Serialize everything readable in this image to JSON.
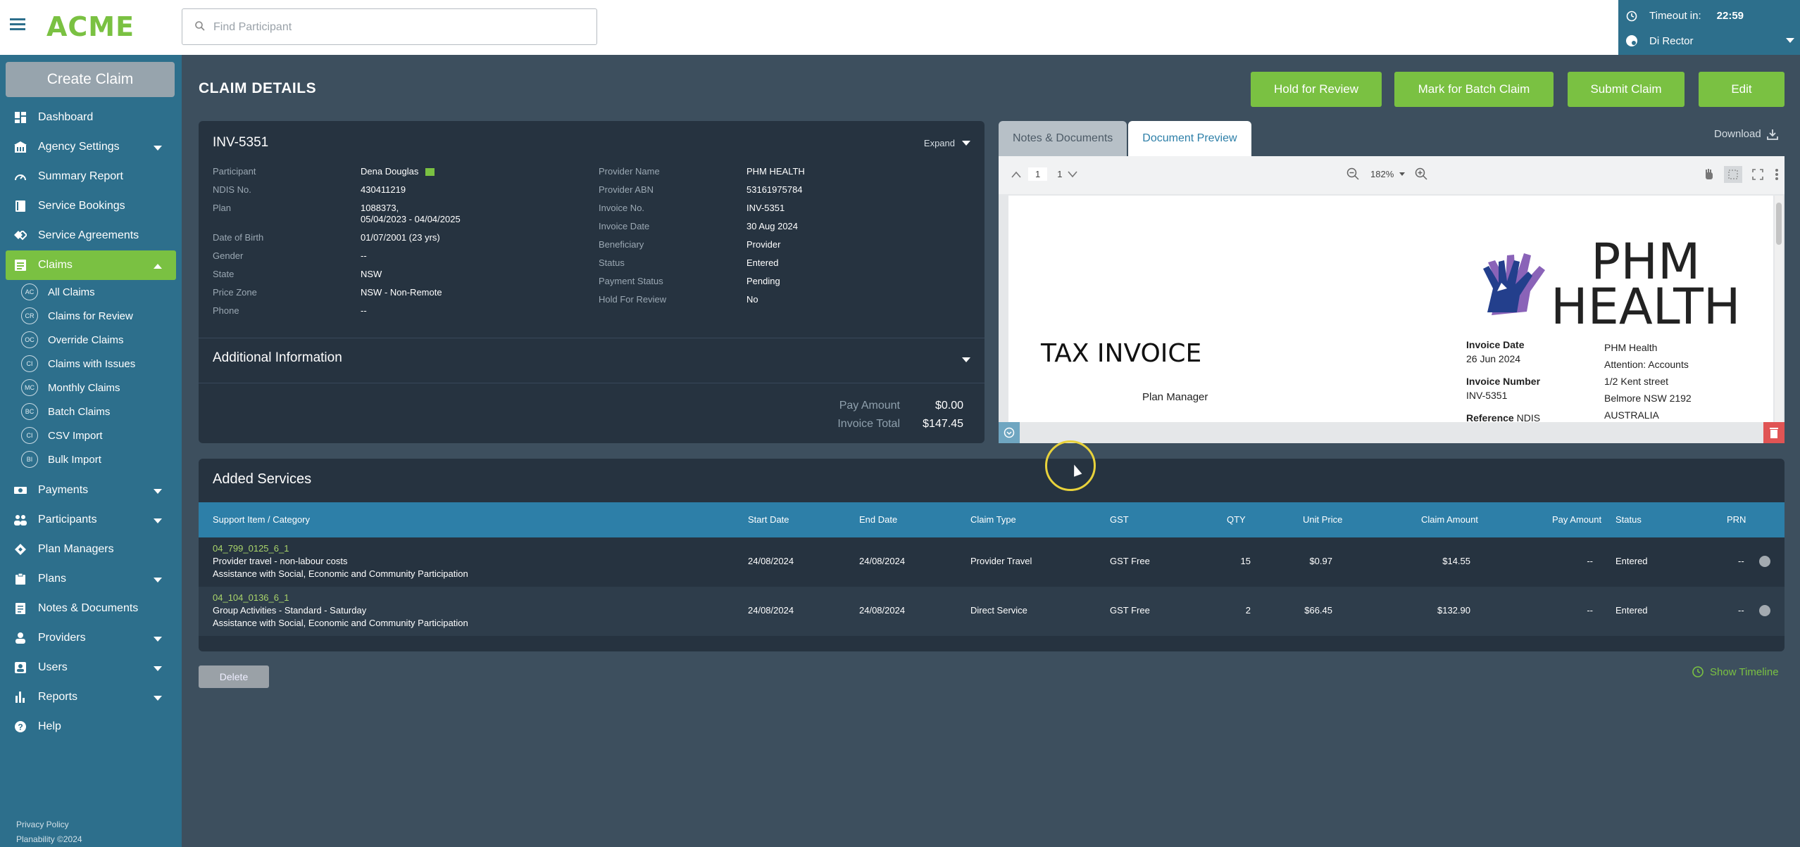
{
  "app": {
    "logo": "ACME",
    "search_placeholder": "Find Participant",
    "timeout_label": "Timeout in:",
    "timeout_value": "22:59",
    "user_name": "Di Rector"
  },
  "sidebar": {
    "create_claim": "Create Claim",
    "items": [
      {
        "label": "Dashboard",
        "icon": "dashboard-icon"
      },
      {
        "label": "Agency Settings",
        "icon": "building-icon"
      },
      {
        "label": "Summary Report",
        "icon": "gauge-icon"
      },
      {
        "label": "Service Bookings",
        "icon": "book-icon"
      },
      {
        "label": "Service Agreements",
        "icon": "handshake-icon"
      },
      {
        "label": "Claims",
        "icon": "list-icon"
      },
      {
        "label": "Payments",
        "icon": "money-icon"
      },
      {
        "label": "Participants",
        "icon": "people-icon"
      },
      {
        "label": "Plan Managers",
        "icon": "diamond-icon"
      },
      {
        "label": "Plans",
        "icon": "clipboard-icon"
      },
      {
        "label": "Notes & Documents",
        "icon": "document-icon"
      },
      {
        "label": "Providers",
        "icon": "provider-icon"
      },
      {
        "label": "Users",
        "icon": "user-icon"
      },
      {
        "label": "Reports",
        "icon": "bar-chart-icon"
      },
      {
        "label": "Help",
        "icon": "question-icon"
      }
    ],
    "claims_sub": [
      {
        "badge": "AC",
        "label": "All Claims"
      },
      {
        "badge": "CR",
        "label": "Claims for Review"
      },
      {
        "badge": "OC",
        "label": "Override Claims"
      },
      {
        "badge": "CI",
        "label": "Claims with Issues"
      },
      {
        "badge": "MC",
        "label": "Monthly Claims"
      },
      {
        "badge": "BC",
        "label": "Batch Claims"
      },
      {
        "badge": "CI",
        "label": "CSV Import"
      },
      {
        "badge": "BI",
        "label": "Bulk Import"
      }
    ],
    "footer": {
      "privacy": "Privacy Policy",
      "copyright": "Planability ©2024"
    }
  },
  "page": {
    "title": "CLAIM DETAILS",
    "actions": {
      "hold": "Hold for Review",
      "batch": "Mark for Batch Claim",
      "submit": "Submit Claim",
      "edit": "Edit"
    }
  },
  "claim": {
    "invoice_id": "INV-5351",
    "expand": "Expand",
    "left_fields": [
      {
        "label": "Participant",
        "value": "Dena Douglas"
      },
      {
        "label": "NDIS No.",
        "value": "430411219"
      },
      {
        "label": "Plan",
        "value": "1088373,",
        "value2": "05/04/2023 - 04/04/2025"
      },
      {
        "label": "Date of Birth",
        "value": "01/07/2001  (23 yrs)"
      },
      {
        "label": "Gender",
        "value": "--"
      },
      {
        "label": "State",
        "value": "NSW"
      },
      {
        "label": "Price Zone",
        "value": "NSW - Non-Remote"
      },
      {
        "label": "Phone",
        "value": "--"
      }
    ],
    "right_fields": [
      {
        "label": "Provider Name",
        "value": "PHM HEALTH"
      },
      {
        "label": "Provider ABN",
        "value": "53161975784"
      },
      {
        "label": "Invoice No.",
        "value": "INV-5351"
      },
      {
        "label": "Invoice Date",
        "value": "30 Aug 2024"
      },
      {
        "label": "Beneficiary",
        "value": "Provider"
      },
      {
        "label": "Status",
        "value": "Entered"
      },
      {
        "label": "Payment Status",
        "value": "Pending"
      },
      {
        "label": "Hold For Review",
        "value": "No"
      }
    ],
    "additional_info": "Additional Information",
    "pay_amount_label": "Pay Amount",
    "pay_amount": "$0.00",
    "invoice_total_label": "Invoice Total",
    "invoice_total": "$147.45"
  },
  "preview": {
    "tabs": [
      "Notes & Documents",
      "Document Preview"
    ],
    "active_tab": "Document Preview",
    "download": "Download",
    "page_current": "1",
    "page_total": "1",
    "zoom": "182%",
    "doc": {
      "title": "TAX INVOICE",
      "subtitle": "Plan Manager",
      "logo_line1": "PHM",
      "logo_line2": "HEALTH",
      "invoice_date_label": "Invoice Date",
      "invoice_date": "26 Jun 2024",
      "invoice_number_label": "Invoice Number",
      "invoice_number": "INV-5351",
      "reference_label": "Reference",
      "reference": "NDIS",
      "address": [
        "PHM Health",
        "Attention: Accounts",
        "1/2 Kent street",
        "Belmore NSW 2192",
        "AUSTRALIA"
      ]
    }
  },
  "services": {
    "title": "Added Services",
    "columns": [
      "Support Item / Category",
      "Start Date",
      "End Date",
      "Claim Type",
      "GST",
      "QTY",
      "Unit Price",
      "Claim Amount",
      "Pay Amount",
      "Status",
      "PRN"
    ],
    "rows": [
      {
        "code": "04_799_0125_6_1",
        "name": "Provider travel - non-labour costs",
        "category": "Assistance with Social, Economic and Community Participation",
        "start": "24/08/2024",
        "end": "24/08/2024",
        "claim_type": "Provider Travel",
        "gst": "GST Free",
        "qty": "15",
        "unit_price": "$0.97",
        "claim_amount": "$14.55",
        "pay_amount": "--",
        "status": "Entered",
        "prn": "--"
      },
      {
        "code": "04_104_0136_6_1",
        "name": "Group Activities - Standard - Saturday",
        "category": "Assistance with Social, Economic and Community Participation",
        "start": "24/08/2024",
        "end": "24/08/2024",
        "claim_type": "Direct Service",
        "gst": "GST Free",
        "qty": "2",
        "unit_price": "$66.45",
        "claim_amount": "$132.90",
        "pay_amount": "--",
        "status": "Entered",
        "prn": "--"
      }
    ],
    "delete": "Delete",
    "show_timeline": "Show Timeline"
  },
  "colors": {
    "brand_green": "#7ac142",
    "sidebar_blue": "#2d6f8c",
    "table_header_blue": "#2d7fa8",
    "background": "#3d4f5e",
    "card": "#263340"
  }
}
